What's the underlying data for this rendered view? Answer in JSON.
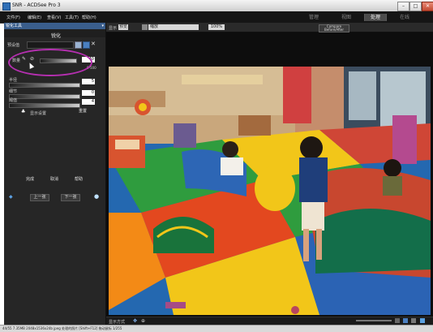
{
  "titlebar": {
    "title": "SNR - ACDSee Pro 3"
  },
  "menu": [
    "文件(F)",
    "编辑(E)",
    "查看(V)",
    "工具(T)",
    "帮助(H)"
  ],
  "modes": [
    {
      "label": "管理",
      "active": false
    },
    {
      "label": "视图",
      "active": false
    },
    {
      "label": "处理",
      "active": true
    },
    {
      "label": "在线",
      "active": false
    }
  ],
  "panel": {
    "header": "锐化工具",
    "title": "锐化",
    "preset_label": "预设值",
    "amount_label": "数量",
    "amount_value": "40",
    "amount_sub": "0-500",
    "radius_label": "半径",
    "radius_value": "5",
    "mask_label": "细节",
    "mask_value": "0",
    "threshold_label": "阈值",
    "threshold_value": "4",
    "reset_label": "重置",
    "action_buttons": [
      "完成",
      "取消",
      "帮助"
    ],
    "footer_buttons": [
      "上一张",
      "下一张"
    ]
  },
  "optbar": {
    "view_label": "显示",
    "mode_label": "预览",
    "select_label": "缩放",
    "zoom_value": "100%",
    "compare_label": "Compare Before/After"
  },
  "imgstatus": {
    "text": "显示方式"
  },
  "statusbar": {
    "text": "44/55 7.35MB 2048x1536x24b jpeg 处理的照片 [Shift+F12] 拖动鼠标 1/255"
  },
  "colors": {
    "accent": "#b52fb0",
    "panel_header": "#3a5e8c",
    "active_mode": "#4c4c4c"
  }
}
